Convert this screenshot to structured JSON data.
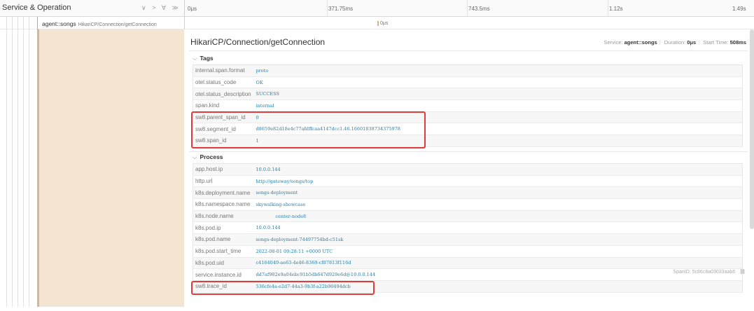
{
  "header": {
    "title": "Service & Operation",
    "controls": "∨ > ∀ ≫",
    "ticks": [
      "0μs",
      "371.75ms",
      "743.5ms",
      "1.12s",
      "1.49s"
    ]
  },
  "span_row": {
    "service": "agent::songs",
    "operation": "HikariCP/Connection/getConnection",
    "bar_label": "0μs"
  },
  "detail": {
    "title": "HikariCP/Connection/getConnection",
    "service_label": "Service:",
    "service_value": "agent::songs",
    "duration_label": "Duration:",
    "duration_value": "0μs",
    "start_label": "Start Time:",
    "start_value": "508ms",
    "tags_label": "Tags",
    "process_label": "Process",
    "span_id": "SpanID: 5c86c8a03033aab6"
  },
  "tags": [
    {
      "key": "internal.span.format",
      "value": "proto"
    },
    {
      "key": "otel.status_code",
      "value": "OK"
    },
    {
      "key": "otel.status_description",
      "value": "SUCCESS"
    },
    {
      "key": "span.kind",
      "value": "internal"
    },
    {
      "key": "sw8.parent_span_id",
      "value": "0"
    },
    {
      "key": "sw8.segment_id",
      "value": "d8659e82d18e4c77afdffcaa4147dcc1.46.16601838734375978"
    },
    {
      "key": "sw8.span_id",
      "value": "1"
    }
  ],
  "process": [
    {
      "key": "app.host.ip",
      "value": "10.0.0.144"
    },
    {
      "key": "http.url",
      "value": "http://gateway/songs/top"
    },
    {
      "key": "k8s.deployment.name",
      "value": "songs-deployment"
    },
    {
      "key": "k8s.namespace.name",
      "value": "skywalking-showcase"
    },
    {
      "key": "k8s.node.name",
      "value": "center-node8"
    },
    {
      "key": "k8s.pod.ip",
      "value": "10.0.0.144"
    },
    {
      "key": "k8s.pod.name",
      "value": "songs-deployment-74497754bd-c51sk"
    },
    {
      "key": "k8s.pod.start_time",
      "value": "2022-08-01 09:28:11 +0000 UTC"
    },
    {
      "key": "k8s.pod.uid",
      "value": "c4164049-ae63-4e46-8369-cf87813f116d"
    },
    {
      "key": "service.instance.id",
      "value": "dd7af982e9a04ebc91b5db647d929e6d@10.0.0.144"
    },
    {
      "key": "sw8.trace_id",
      "value": "536cfe4a-e2d7-44a3-9b3f-a22b90494dcb"
    }
  ],
  "colors": {
    "highlight": "#e03c3c",
    "value_text": "#2c7da0",
    "span_panel": "#f4e4d2"
  }
}
